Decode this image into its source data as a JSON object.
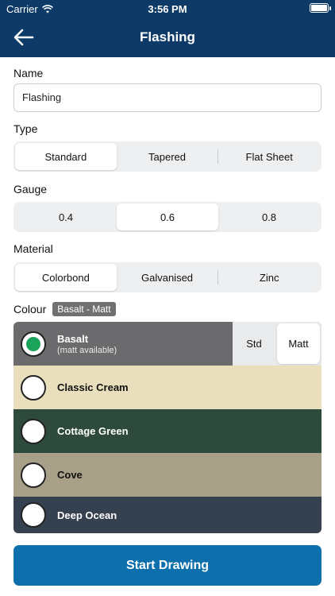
{
  "status": {
    "carrier": "Carrier",
    "time": "3:56 PM"
  },
  "nav": {
    "title": "Flashing",
    "back_icon": "arrow-left-icon"
  },
  "name": {
    "label": "Name",
    "value": "Flashing"
  },
  "type": {
    "label": "Type",
    "options": [
      "Standard",
      "Tapered",
      "Flat Sheet"
    ],
    "selected": "Standard"
  },
  "gauge": {
    "label": "Gauge",
    "options": [
      "0.4",
      "0.6",
      "0.8"
    ],
    "selected": "0.6"
  },
  "material": {
    "label": "Material",
    "options": [
      "Colorbond",
      "Galvanised",
      "Zinc"
    ],
    "selected": "Colorbond"
  },
  "colour": {
    "label": "Colour",
    "badge": "Basalt - Matt",
    "finish_options": [
      "Std",
      "Matt"
    ],
    "finish_selected": "Matt",
    "items": [
      {
        "name": "Basalt",
        "sub": "(matt available)",
        "color": "#6b6b6e",
        "text_color": "#ffffff",
        "selected": true
      },
      {
        "name": "Classic Cream",
        "color": "#e9dfbc",
        "text_color": "#111111",
        "selected": false
      },
      {
        "name": "Cottage Green",
        "color": "#2e4a3c",
        "text_color": "#ffffff",
        "selected": false
      },
      {
        "name": "Cove",
        "color": "#a89f88",
        "text_color": "#111111",
        "selected": false
      },
      {
        "name": "Deep Ocean",
        "color": "#364150",
        "text_color": "#ffffff",
        "selected": false
      }
    ]
  },
  "cta": {
    "label": "Start Drawing"
  },
  "colors": {
    "nav_bg": "#0d3a66",
    "cta_bg": "#0d6fab",
    "radio_selected": "#1aa45a"
  }
}
